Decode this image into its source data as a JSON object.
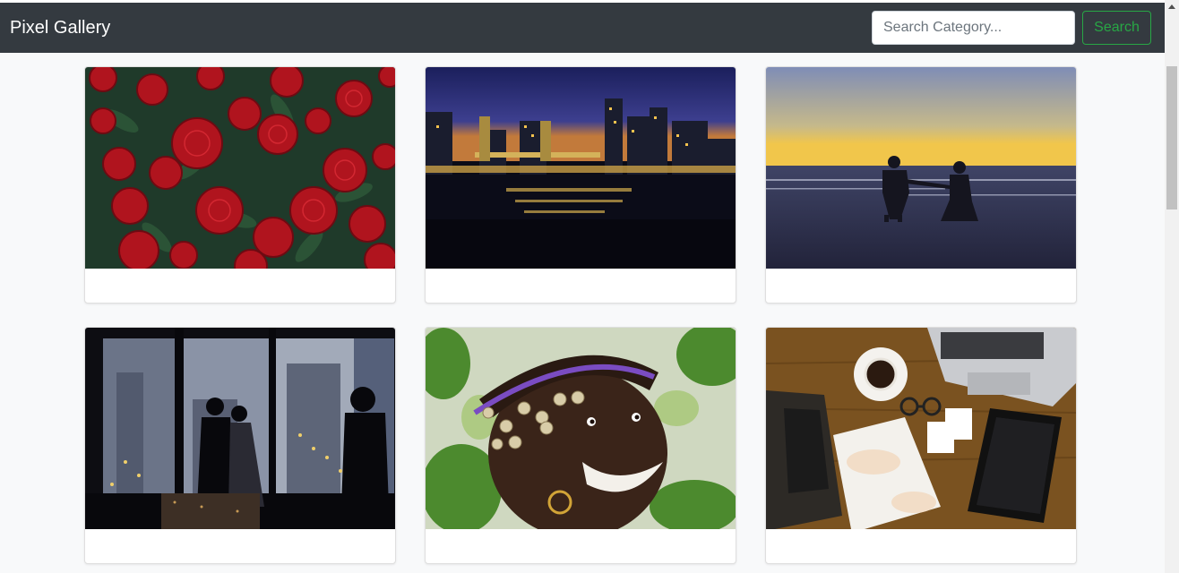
{
  "navbar": {
    "brand": "Pixel Gallery",
    "search_placeholder": "Search Category...",
    "search_label": "Search",
    "accent_color": "#28a745",
    "background_color": "#343a40"
  },
  "gallery": {
    "items": [
      {
        "subject": "red-roses-photo"
      },
      {
        "subject": "city-night-bridge-photo"
      },
      {
        "subject": "beach-sunset-couple-photo"
      },
      {
        "subject": "wedding-couple-window-photo"
      },
      {
        "subject": "smiling-woman-headdress-photo"
      },
      {
        "subject": "desk-laptop-coffee-photo"
      }
    ]
  }
}
